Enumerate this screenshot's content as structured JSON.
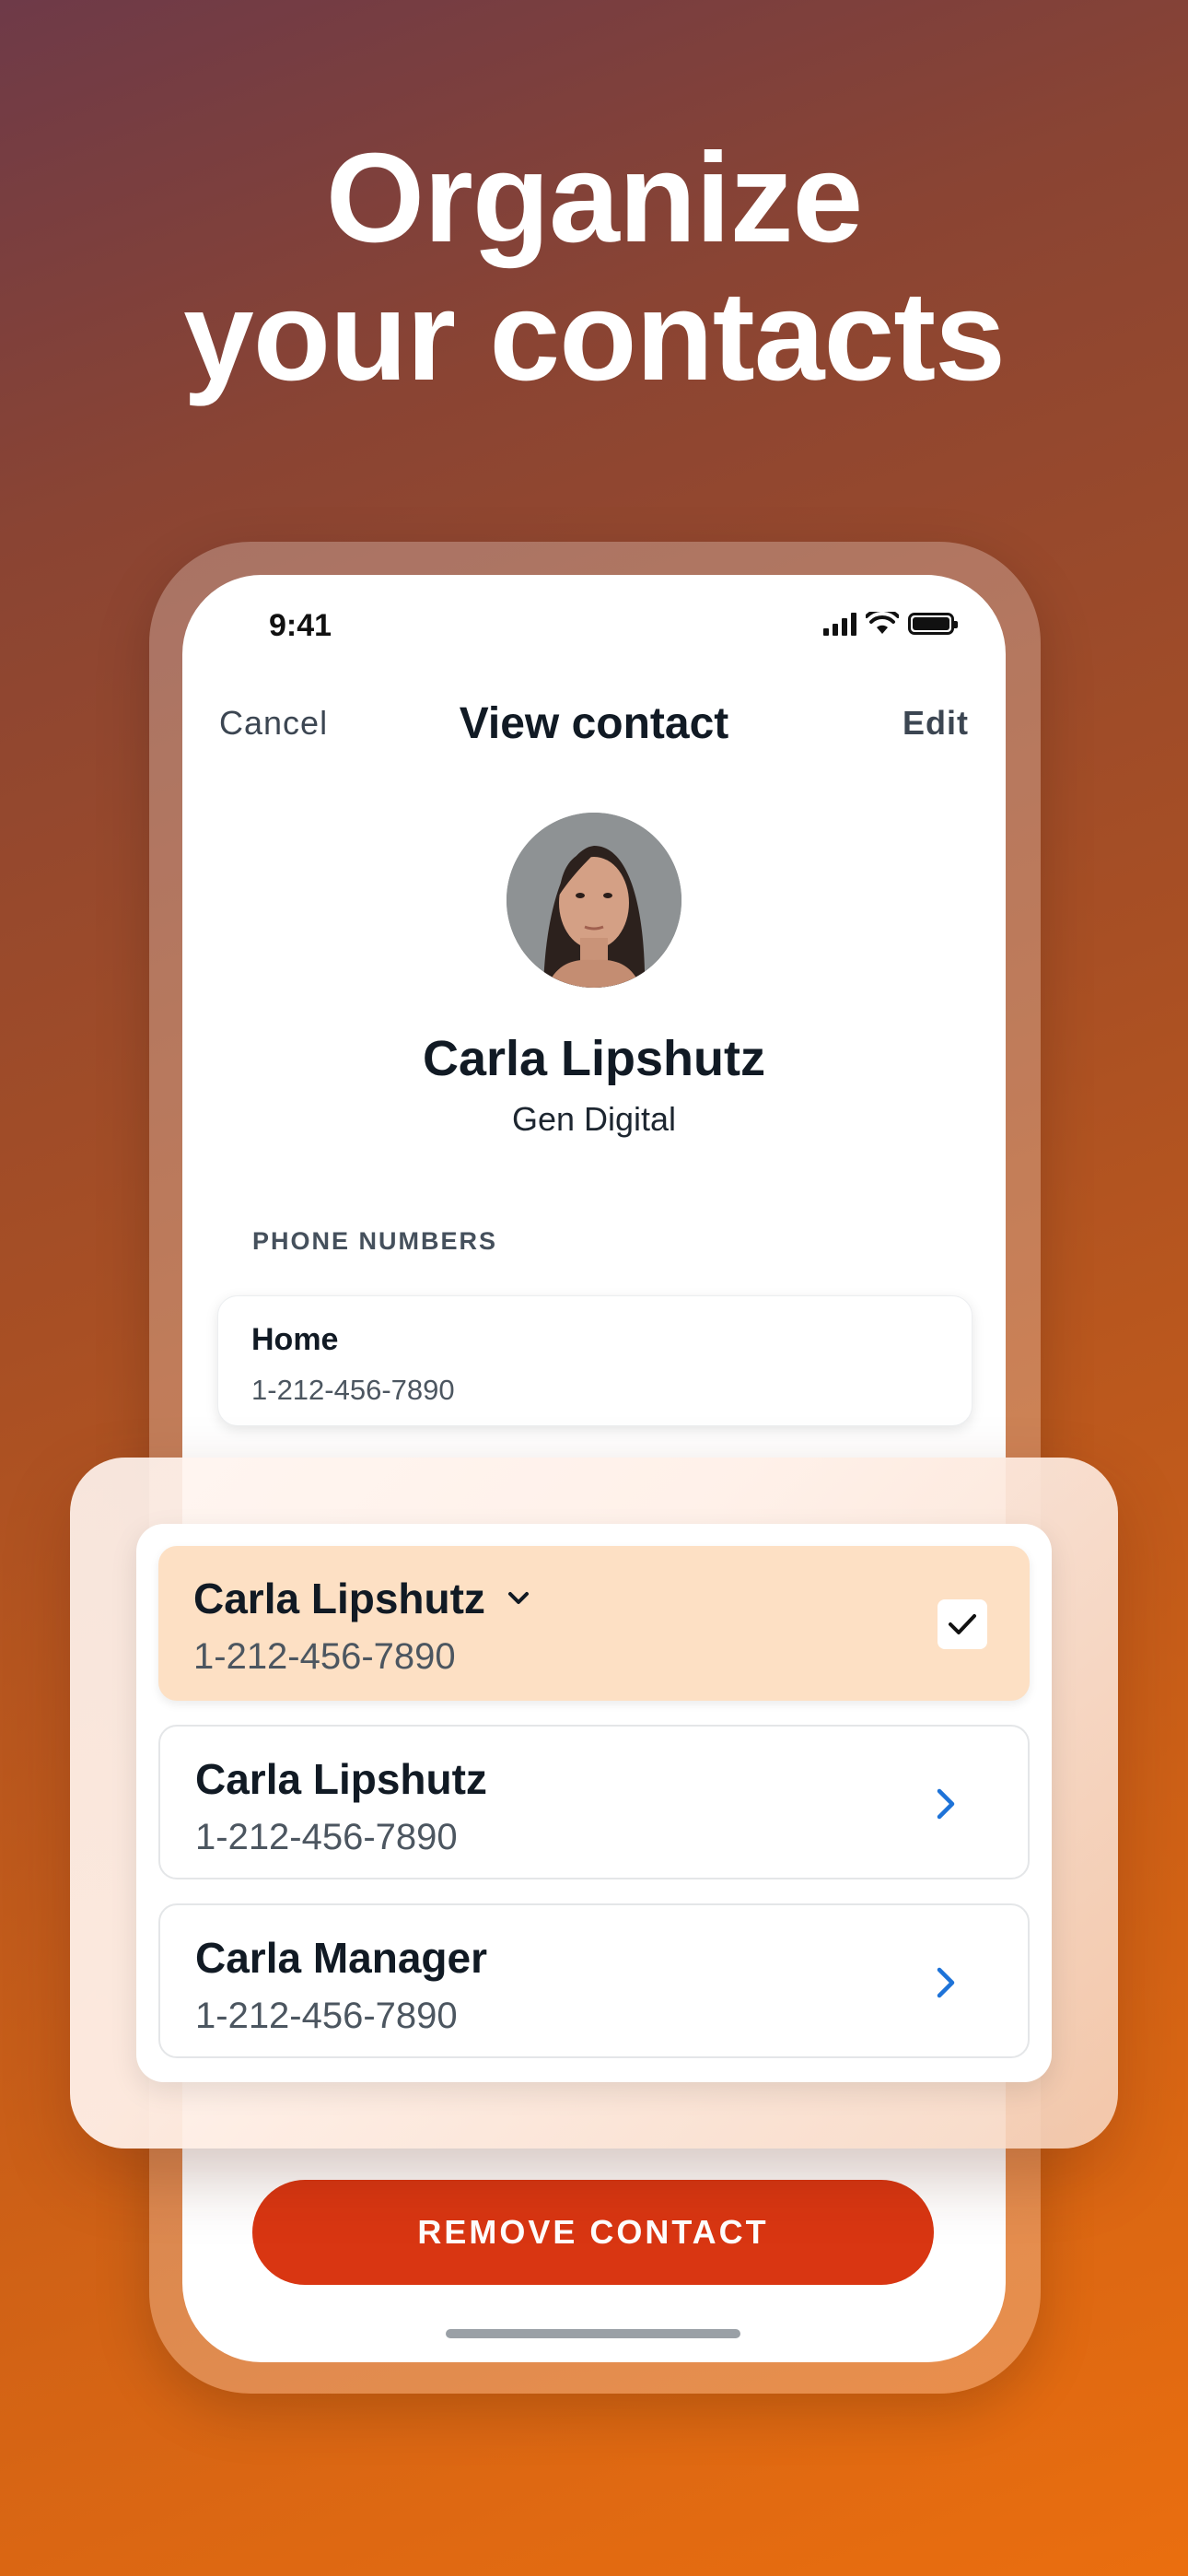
{
  "headline": {
    "line1": "Organize",
    "line2": "your contacts"
  },
  "status_bar": {
    "time": "9:41"
  },
  "nav": {
    "cancel": "Cancel",
    "title": "View contact",
    "edit": "Edit"
  },
  "contact": {
    "name": "Carla Lipshutz",
    "company": "Gen Digital"
  },
  "phone_numbers": {
    "section_label": "PHONE NUMBERS",
    "items": [
      {
        "label": "Home",
        "number": "1-212-456-7890"
      }
    ]
  },
  "matches": [
    {
      "name": "Carla Lipshutz",
      "number": "1-212-456-7890",
      "selected": true
    },
    {
      "name": "Carla Lipshutz",
      "number": "1-212-456-7890",
      "selected": false
    },
    {
      "name": "Carla Manager",
      "number": "1-212-456-7890",
      "selected": false
    }
  ],
  "remove_button": {
    "label": "REMOVE CONTACT"
  },
  "colors": {
    "accent": "#d93612",
    "chevron": "#1e73d8",
    "selected_row": "#fde0c4"
  },
  "icons": [
    "signal-icon",
    "wifi-icon",
    "battery-icon",
    "chevron-down-icon",
    "checkmark-icon",
    "chevron-right-icon"
  ]
}
